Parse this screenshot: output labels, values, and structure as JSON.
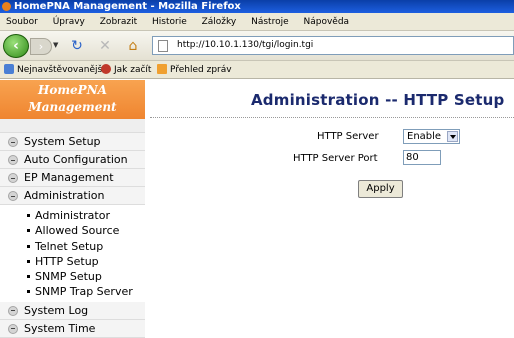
{
  "window": {
    "title": "HomePNA Management - Mozilla Firefox"
  },
  "menubar": {
    "items": [
      "Soubor",
      "Úpravy",
      "Zobrazit",
      "Historie",
      "Záložky",
      "Nástroje",
      "Nápověda"
    ]
  },
  "toolbar": {
    "url": "http://10.10.1.130/tgi/login.tgi"
  },
  "bookmarks": {
    "items": [
      "Nejnavštěvovanější",
      "Jak začít",
      "Přehled zpráv"
    ]
  },
  "logo": {
    "line1": "HomePNA",
    "line2": "Management"
  },
  "sidebar": {
    "items": [
      "System Setup",
      "Auto Configuration",
      "EP Management",
      "Administration"
    ],
    "subitems": [
      "Administrator",
      "Allowed Source",
      "Telnet Setup",
      "HTTP Setup",
      "SNMP Setup",
      "SNMP Trap Server"
    ],
    "bottom_items": [
      "System Log",
      "System Time"
    ]
  },
  "main": {
    "heading": "Administration -- HTTP Setup",
    "http_server_label": "HTTP Server",
    "http_server_value": "Enable",
    "port_label": "HTTP Server Port",
    "port_value": "80",
    "apply_label": "Apply"
  },
  "colors": {
    "logo_bg": "#f0882f",
    "heading": "#1b2a6e",
    "titlebar": "#0a3fa8"
  }
}
